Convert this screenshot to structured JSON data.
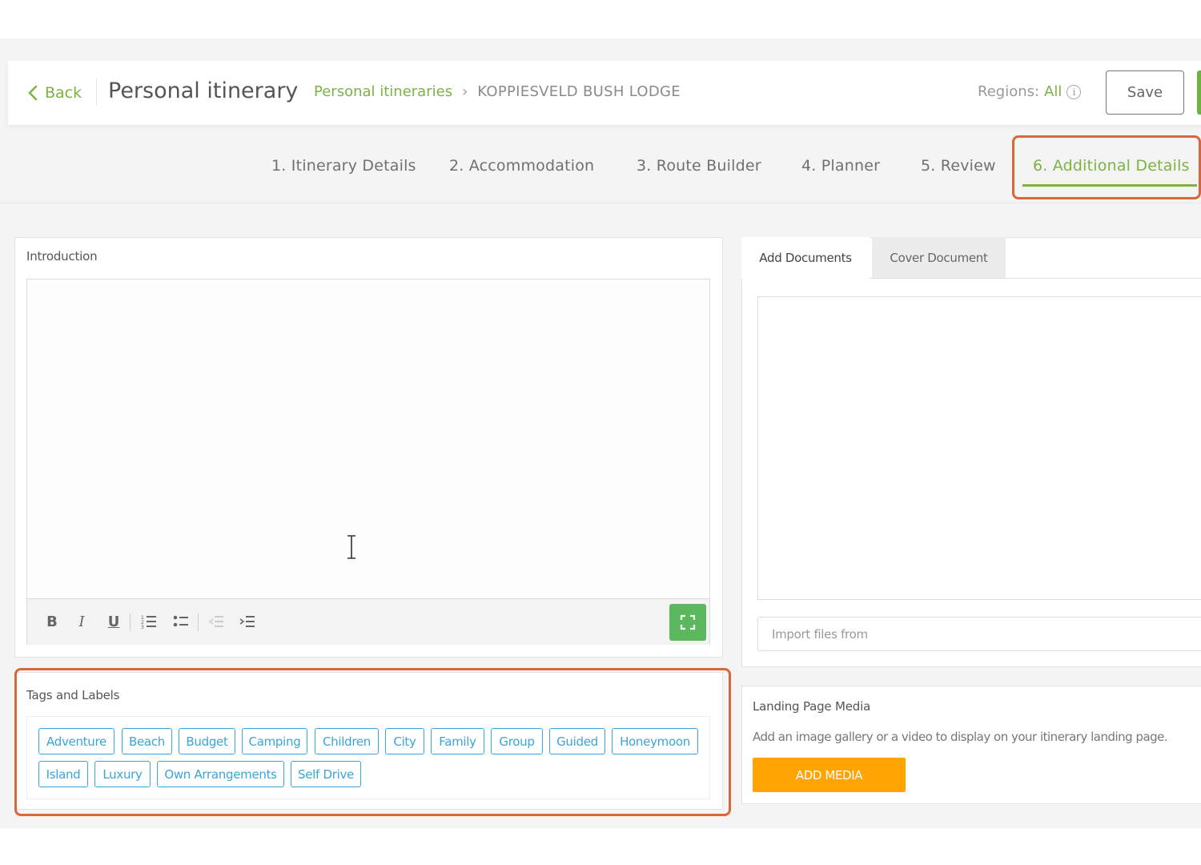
{
  "header": {
    "back_label": "Back",
    "title": "Personal itinerary",
    "breadcrumb": {
      "link": "Personal itineraries",
      "separator": "›",
      "current": "KOPPIESVELD BUSH LODGE"
    },
    "regions_label": "Regions:",
    "regions_value": "All",
    "save_label": "Save"
  },
  "steps": [
    {
      "label": "1. Itinerary Details",
      "active": false
    },
    {
      "label": "2. Accommodation",
      "active": false
    },
    {
      "label": "3. Route Builder",
      "active": false
    },
    {
      "label": "4. Planner",
      "active": false
    },
    {
      "label": "5. Review",
      "active": false
    },
    {
      "label": "6. Additional Details",
      "active": true
    }
  ],
  "introduction": {
    "label": "Introduction",
    "content": "",
    "toolbar": [
      "bold-icon",
      "italic-icon",
      "underline-icon",
      "ordered-list-icon",
      "bullet-list-icon",
      "outdent-icon",
      "indent-icon",
      "fullscreen-icon"
    ]
  },
  "tags": {
    "label": "Tags and Labels",
    "items": [
      "Adventure",
      "Beach",
      "Budget",
      "Camping",
      "Children",
      "City",
      "Family",
      "Group",
      "Guided",
      "Honeymoon",
      "Island",
      "Luxury",
      "Own Arrangements",
      "Self Drive"
    ]
  },
  "documents": {
    "tabs": [
      {
        "label": "Add Documents",
        "active": true
      },
      {
        "label": "Cover Document",
        "active": false
      }
    ],
    "import_placeholder": "Import files from"
  },
  "landing_media": {
    "title": "Landing Page Media",
    "description": "Add an image gallery or a video to display on your itinerary landing page.",
    "button_label": "ADD MEDIA"
  },
  "colors": {
    "accent_green": "#7cb342",
    "tag_blue": "#39a6d8",
    "highlight_orange": "#d9673a",
    "button_orange": "#ffa400"
  }
}
